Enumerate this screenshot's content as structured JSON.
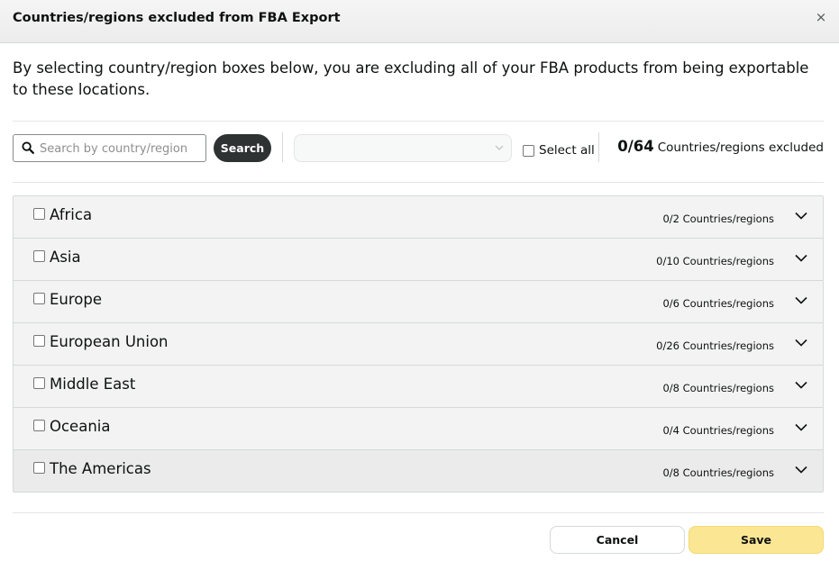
{
  "header": {
    "title": "Countries/regions excluded from FBA Export",
    "close_label": "×"
  },
  "description": "By selecting country/region boxes below, you are excluding all of your FBA products from being exportable to these locations.",
  "search": {
    "placeholder": "Search by country/region",
    "value": "",
    "button_label": "Search"
  },
  "filter_dropdown": {
    "value": ""
  },
  "select_all": {
    "label": "Select all",
    "checked": false
  },
  "excluded_summary": {
    "count": "0/64",
    "label": "Countries/regions excluded"
  },
  "regions": [
    {
      "name": "Africa",
      "count": "0/2 Countries/regions"
    },
    {
      "name": "Asia",
      "count": "0/10 Countries/regions"
    },
    {
      "name": "Europe",
      "count": "0/6 Countries/regions"
    },
    {
      "name": "European Union",
      "count": "0/26 Countries/regions"
    },
    {
      "name": "Middle East",
      "count": "0/8 Countries/regions"
    },
    {
      "name": "Oceania",
      "count": "0/4 Countries/regions"
    },
    {
      "name": "The Americas",
      "count": "0/8 Countries/regions"
    }
  ],
  "footer": {
    "cancel_label": "Cancel",
    "save_label": "Save"
  },
  "colors": {
    "save_button": "#fbe694",
    "search_button": "#2f3232",
    "header_bg": "#f0f0f0",
    "row_bg": "#f3f3f3"
  },
  "icons": {
    "close": "close-icon",
    "search": "search-icon",
    "dropdown": "chevron-down-icon",
    "expand": "chevron-down-icon"
  }
}
